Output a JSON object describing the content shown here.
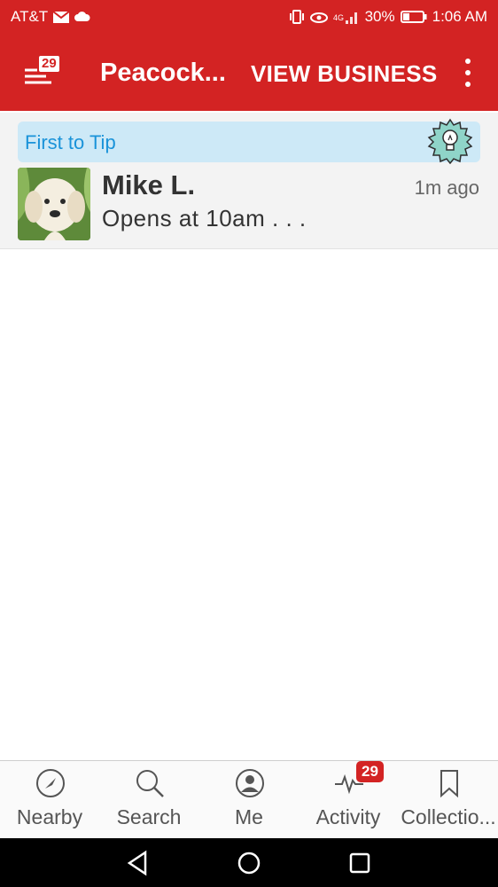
{
  "status_bar": {
    "carrier": "AT&T",
    "battery": "30%",
    "time": "1:06 AM"
  },
  "app_bar": {
    "menu_badge": "29",
    "title": "Peacock...",
    "view_business": "VIEW BUSINESS"
  },
  "tip": {
    "banner": "First to Tip",
    "user_name": "Mike L.",
    "time_ago": "1m ago",
    "text": "Opens at 10am . . ."
  },
  "tabs": [
    {
      "label": "Nearby",
      "icon": "compass-icon"
    },
    {
      "label": "Search",
      "icon": "search-icon"
    },
    {
      "label": "Me",
      "icon": "profile-icon"
    },
    {
      "label": "Activity",
      "icon": "activity-icon",
      "badge": "29"
    },
    {
      "label": "Collectio...",
      "icon": "bookmark-icon"
    }
  ],
  "colors": {
    "brand": "#d32323",
    "tip_banner": "#cde9f7",
    "tip_text": "#1a93d9"
  }
}
